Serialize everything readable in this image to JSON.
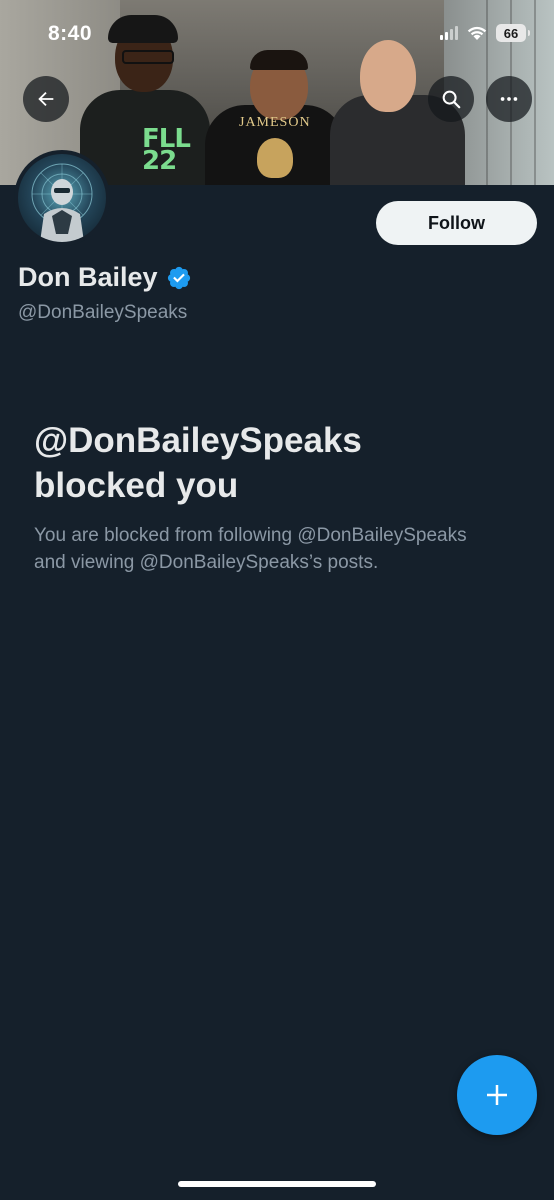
{
  "status_bar": {
    "time": "8:40",
    "battery": "66"
  },
  "profile": {
    "display_name": "Don Bailey",
    "handle": "@DonBaileySpeaks",
    "follow_label": "Follow",
    "verified": true
  },
  "banner": {
    "shirt_text_1": "FLL\n22",
    "shirt_text_2": "JAMESON"
  },
  "blocked": {
    "title_line1": "@DonBaileySpeaks",
    "title_line2": "blocked you",
    "description_line1": "You are blocked from following @DonBaileySpeaks",
    "description_line2": "and viewing @DonBaileySpeaks’s posts."
  },
  "icons": {
    "back": "arrow-left-icon",
    "search": "search-icon",
    "more": "more-horizontal-icon",
    "verified": "verified-badge-icon",
    "compose": "plus-icon",
    "signal": "cellular-signal-icon",
    "wifi": "wifi-icon",
    "battery": "battery-icon"
  },
  "colors": {
    "background": "#15202b",
    "accent": "#1d9bf0",
    "primary_text": "#e7e9ea",
    "secondary_text": "#8b98a5"
  }
}
